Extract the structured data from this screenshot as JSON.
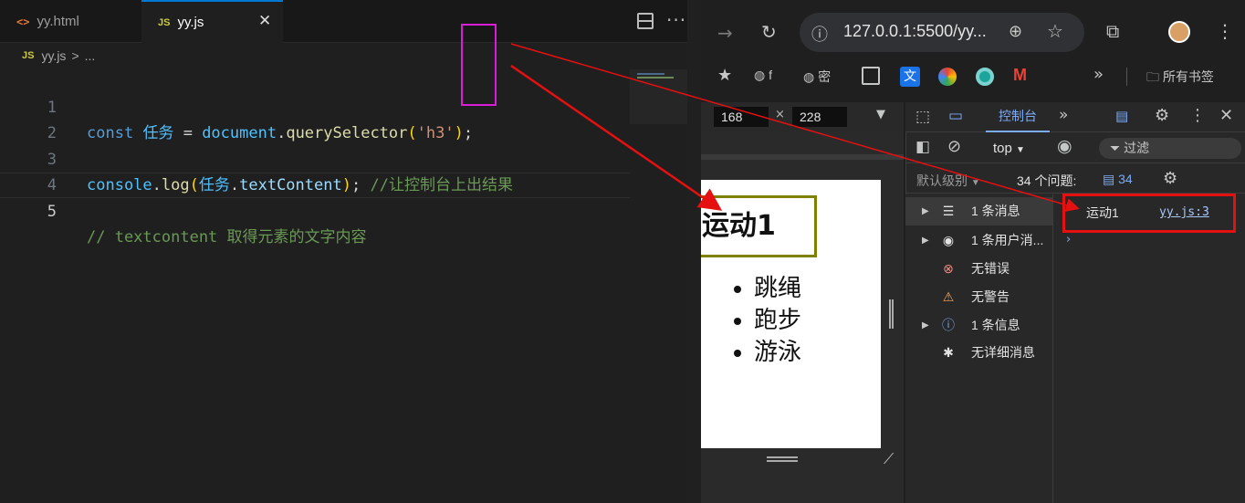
{
  "editor": {
    "tabs": [
      {
        "icon": "html-file-icon",
        "glyph": "<>",
        "label": "yy.html"
      },
      {
        "icon": "js-file-icon",
        "glyph": "JS",
        "label": "yy.js",
        "close": "✕"
      }
    ],
    "breadcrumb": {
      "glyph": "JS",
      "file": "yy.js",
      "sep": ">",
      "rest": "..."
    },
    "more": "···",
    "lines": [
      {
        "num": "1"
      },
      {
        "num": "2"
      },
      {
        "num": "3"
      },
      {
        "num": "4"
      },
      {
        "num": "5"
      }
    ],
    "code": {
      "l1": {
        "kw": "const",
        "var": "任务",
        "eq": "=",
        "obj": "document",
        "dot": ".",
        "fn": "querySelector",
        "open": "(",
        "q1": "'",
        "str": "h3",
        "q2": "'",
        "close": ")",
        "semi": ";"
      },
      "l3": {
        "obj": "console",
        "dot": ".",
        "fn": "log",
        "open": "(",
        "var": "任务",
        "dot2": ".",
        "prop": "textContent",
        "close": ")",
        "semi": ";",
        "comment": "//让控制台上出结果"
      },
      "l5": {
        "comment": "// textcontent 取得元素的文字内容"
      }
    }
  },
  "browser": {
    "url": "127.0.0.1:5500/yy...",
    "bookmarks": [
      {
        "icon": "globe-icon",
        "label": "f"
      },
      {
        "icon": "globe-icon",
        "label": "密"
      }
    ],
    "bookmarks_more": "»",
    "all_bookmarks": "所有书签",
    "device": {
      "width": "168",
      "height": "228",
      "times": "×"
    },
    "page": {
      "heading": "运动1",
      "list": [
        "跳绳",
        "跑步",
        "游泳"
      ]
    }
  },
  "devtools": {
    "console_tab": "控制台",
    "more_tabs": "»",
    "context": "top",
    "filter": "过滤",
    "default_levels": "默认级别",
    "issues_label": "34 个问题:",
    "issues_count": "34",
    "sidebar": [
      {
        "icon": "list-icon",
        "glyph": "☰",
        "label": "1 条消息",
        "arrow": "▶"
      },
      {
        "icon": "user-icon",
        "glyph": "◉",
        "label": "1 条用户消...",
        "arrow": "▶"
      },
      {
        "icon": "error-icon",
        "glyph": "⊗",
        "label": "无错误",
        "arrow": ""
      },
      {
        "icon": "warning-icon",
        "glyph": "⚠",
        "label": "无警告",
        "arrow": ""
      },
      {
        "icon": "info-icon",
        "glyph": "ⓘ",
        "label": "1 条信息",
        "arrow": "▶"
      },
      {
        "icon": "bug-icon",
        "glyph": "✱",
        "label": "无详细消息",
        "arrow": ""
      }
    ],
    "log": {
      "text": "运动1",
      "source": "yy.js:3"
    }
  },
  "colors": {
    "annotation_red": "#e51010",
    "annotation_magenta": "#d81ed8",
    "accent": "#7cacf8"
  }
}
